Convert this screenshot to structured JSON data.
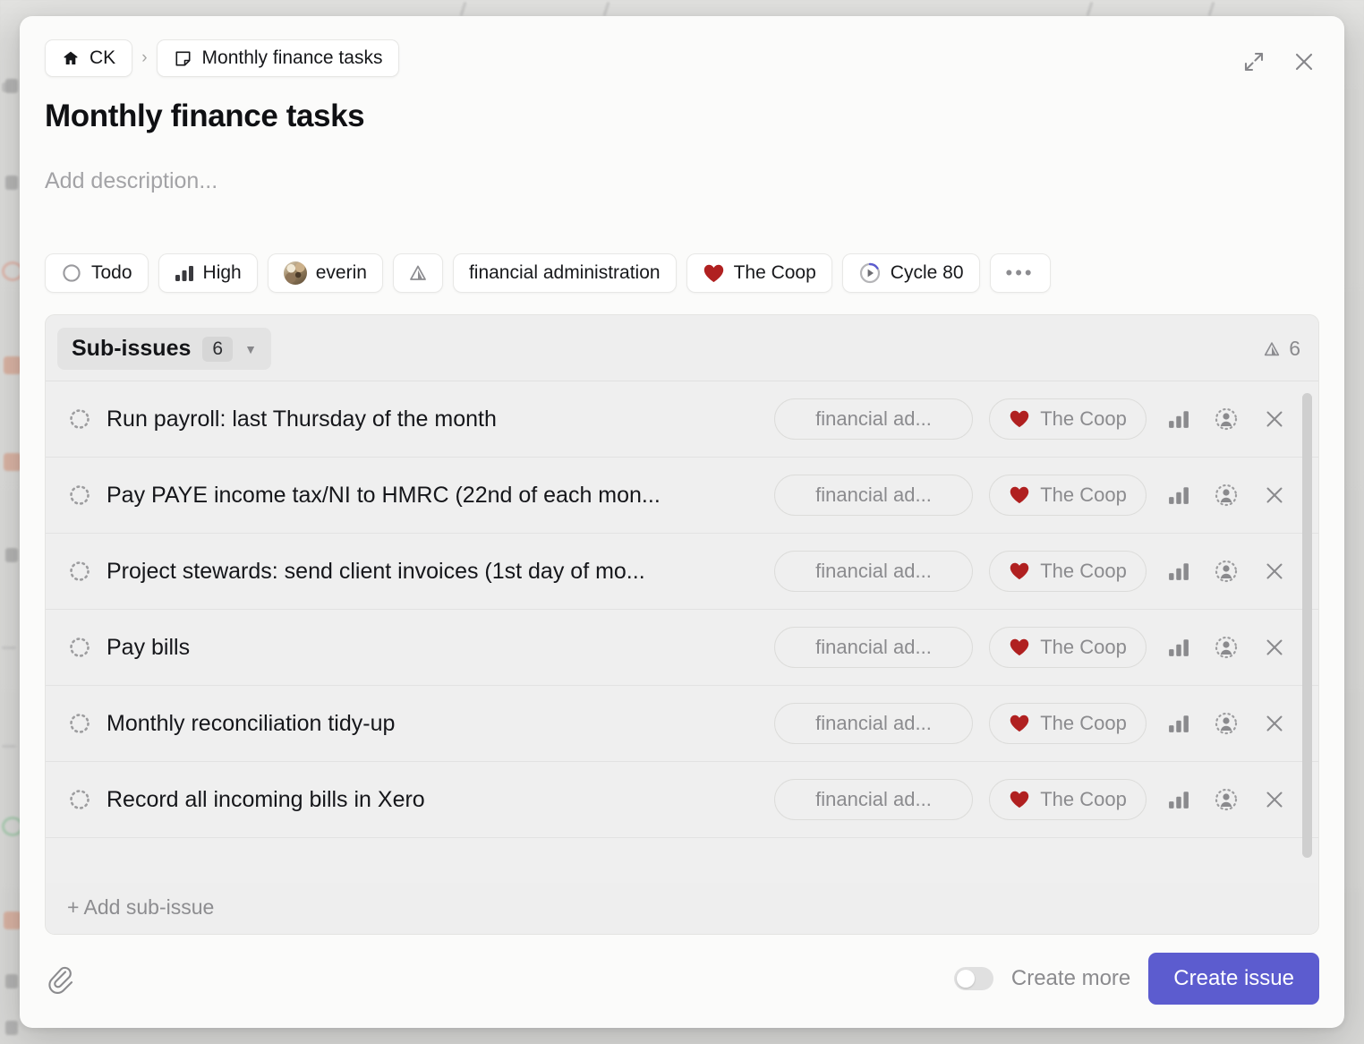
{
  "breadcrumb": {
    "home": {
      "label": "CK",
      "icon": "home-icon"
    },
    "separator": "›",
    "current": {
      "label": "Monthly finance tasks",
      "icon": "note-icon"
    }
  },
  "window_controls": {
    "expand": {
      "icon": "expand-icon",
      "title": "Expand"
    },
    "close": {
      "icon": "close-icon",
      "title": "Close"
    }
  },
  "issue": {
    "title": "Monthly finance tasks",
    "description_placeholder": "Add description..."
  },
  "properties": [
    {
      "name": "status",
      "label": "Todo",
      "icon": "todo-circle-icon"
    },
    {
      "name": "priority",
      "label": "High",
      "icon": "priority-bars-icon"
    },
    {
      "name": "assignee",
      "label": "everin",
      "icon": "avatar-image"
    },
    {
      "name": "estimate",
      "label": "",
      "icon": "triangle-estimate-icon"
    },
    {
      "name": "label",
      "label": "financial administration",
      "icon": ""
    },
    {
      "name": "team",
      "label": "The Coop",
      "icon": "heart-icon"
    },
    {
      "name": "cycle",
      "label": "Cycle 80",
      "icon": "cycle-progress-icon"
    },
    {
      "name": "more",
      "label": "•••",
      "icon": "more-options-icon"
    }
  ],
  "sub_issues": {
    "header": {
      "title": "Sub-issues",
      "count": "6",
      "caret": "▼",
      "right_icon": "triangle-estimate-icon",
      "right_count": "6"
    },
    "rows": [
      {
        "title": "Run payroll: last Thursday of the month",
        "status_icon": "backlog-dotted-circle-icon",
        "label": "financial ad...",
        "team": "The Coop"
      },
      {
        "title": "Pay PAYE income tax/NI to HMRC (22nd of each mon...",
        "status_icon": "backlog-dotted-circle-icon",
        "label": "financial ad...",
        "team": "The Coop"
      },
      {
        "title": "Project stewards: send client invoices (1st day of mo...",
        "status_icon": "backlog-dotted-circle-icon",
        "label": "financial ad...",
        "team": "The Coop"
      },
      {
        "title": "Pay bills",
        "status_icon": "backlog-dotted-circle-icon",
        "label": "financial ad...",
        "team": "The Coop"
      },
      {
        "title": "Monthly reconciliation tidy-up",
        "status_icon": "backlog-dotted-circle-icon",
        "label": "financial ad...",
        "team": "The Coop"
      },
      {
        "title": "Record all incoming bills in Xero",
        "status_icon": "backlog-dotted-circle-icon",
        "label": "financial ad...",
        "team": "The Coop"
      }
    ],
    "row_icons": {
      "priority": "priority-bars-icon",
      "assignee": "unassigned-person-icon",
      "remove": "close-icon"
    },
    "add_label": "+ Add sub-issue"
  },
  "footer": {
    "attach_icon": "paperclip-icon",
    "create_more_label": "Create more",
    "create_more_on": false,
    "create_button_label": "Create issue"
  },
  "colors": {
    "accent": "#5c5ccf",
    "team_heart": "#b02020",
    "modal_bg": "#fbfbfa",
    "section_bg": "#eeeeee"
  }
}
